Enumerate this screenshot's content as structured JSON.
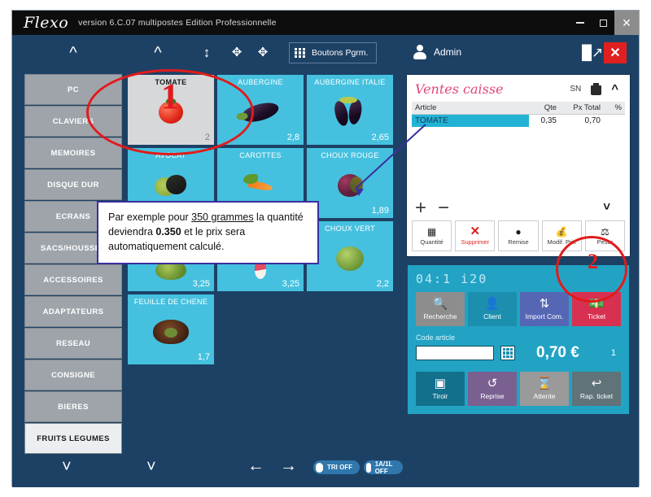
{
  "window": {
    "app_name": "Flexo",
    "version_text": "version 6.C.07 multipostes Edition Professionnelle",
    "minimize_icon": "minimize-icon",
    "maximize_icon": "maximize-icon",
    "close_icon": "close-icon"
  },
  "toolbar": {
    "icons": [
      "chevron-up-icon",
      "chevron-up-icon",
      "arrows-vertical-icon",
      "expand-icon",
      "collapse-icon"
    ],
    "pgrm_button_label": "Boutons Pgrm.",
    "user_label": "Admin",
    "theme_icon": "paint-bucket-icon",
    "close_label": "✕"
  },
  "sidebar": {
    "items": [
      {
        "label": "PC",
        "active": false
      },
      {
        "label": "CLAVIERS",
        "active": false
      },
      {
        "label": "MEMOIRES",
        "active": false
      },
      {
        "label": "DISQUE DUR",
        "active": false
      },
      {
        "label": "ECRANS",
        "active": false
      },
      {
        "label": "SACS/HOUSSES",
        "active": false
      },
      {
        "label": "ACCESSOIRES",
        "active": false
      },
      {
        "label": "ADAPTATEURS",
        "active": false
      },
      {
        "label": "RESEAU",
        "active": false
      },
      {
        "label": "CONSIGNE",
        "active": false
      },
      {
        "label": "BIERES",
        "active": false
      },
      {
        "label": "FRUITS LEGUMES",
        "active": true
      }
    ]
  },
  "product_grid": {
    "rows": [
      [
        {
          "name": "TOMATE",
          "price": "2",
          "selected": true,
          "img": "tomato"
        },
        {
          "name": "AUBERGINE",
          "price": "2,8",
          "selected": false,
          "img": "aubergine"
        },
        {
          "name": "AUBERGINE ITALIE",
          "price": "2,65",
          "selected": false,
          "img": "aubergine2"
        }
      ],
      [
        {
          "name": "AVOCAT",
          "price": "",
          "selected": false,
          "img": "avocat"
        },
        {
          "name": "CAROTTES",
          "price": "",
          "selected": false,
          "img": "carrot"
        },
        {
          "name": "CHOUX ROUGE",
          "price": "1,89",
          "selected": false,
          "img": "chourouge"
        }
      ],
      [
        {
          "name": "",
          "price": "3,25",
          "selected": false,
          "img": "salade"
        },
        {
          "name": "",
          "price": "3,25",
          "selected": false,
          "img": "radis"
        },
        {
          "name": "CHOUX VERT",
          "price": "2,2",
          "selected": false,
          "img": "chouvert"
        }
      ],
      [
        {
          "name": "FEUILLE DE CHENE",
          "price": "1,7",
          "selected": false,
          "img": "feuille"
        }
      ]
    ]
  },
  "bottom_nav": {
    "icons": [
      "chevron-down-icon",
      "chevron-down-icon",
      "arrow-left-icon",
      "arrow-right-icon"
    ],
    "toggles": [
      {
        "label": "TRI OFF"
      },
      {
        "label": "1A/1L OFF"
      }
    ]
  },
  "sale_panel": {
    "title": "Ventes caisse",
    "sn_label": "SN",
    "trash_icon": "trash-icon",
    "collapse_icon": "chevron-up-icon",
    "columns": [
      "Article",
      "Qte",
      "Px Total",
      "%"
    ],
    "rows": [
      {
        "article": "TOMATE",
        "qte": "0,35",
        "px_total": "0,70",
        "pct": "",
        "selected": true
      }
    ],
    "plus_label": "+",
    "minus_label": "−",
    "expand_icon": "chevron-down-icon",
    "actions": [
      {
        "label": "Quantité",
        "icon": "calculator-icon",
        "danger": false
      },
      {
        "label": "Supprimer",
        "icon": "cross-icon",
        "danger": true
      },
      {
        "label": "Remise",
        "icon": "percent-icon",
        "danger": false
      },
      {
        "label": "Modif. Prix",
        "icon": "money-tag-icon",
        "danger": false
      },
      {
        "label": "Peser",
        "icon": "scale-icon",
        "danger": false
      }
    ]
  },
  "cash_panel": {
    "clock": "04:1 i20",
    "top_buttons": [
      {
        "label": "Recherche",
        "icon": "search-icon",
        "color": "#8d8d8d"
      },
      {
        "label": "Client",
        "icon": "client-icon",
        "color": "#1d8fae"
      },
      {
        "label": "Import Com.",
        "icon": "import-icon",
        "color": "#5566b5"
      },
      {
        "label": "Ticket",
        "icon": "banknote-icon",
        "color": "#d83050"
      }
    ],
    "code_label": "Code article",
    "code_value": "",
    "code_placeholder": "",
    "keypad_icon": "calculator-icon",
    "total": "0,70 €",
    "item_count": "1",
    "bottom_buttons": [
      {
        "label": "Tiroir",
        "icon": "drawer-icon",
        "color": "#12708c"
      },
      {
        "label": "Reprise",
        "icon": "undo-icon",
        "color": "#7a6090"
      },
      {
        "label": "Attente",
        "icon": "hourglass-icon",
        "color": "#9a9a9a"
      },
      {
        "label": "Rap. ticket",
        "icon": "return-arrow-icon",
        "color": "#5f7379"
      }
    ]
  },
  "annotations": {
    "marker_1": "1",
    "marker_2": "2",
    "callout_line1_a": "Par exemple pour ",
    "callout_line1_b": "350 grammes",
    "callout_line1_c": " la",
    "callout_line2_a": "quantité deviendra ",
    "callout_line2_b": "0.350",
    "callout_line2_c": " et le prix",
    "callout_line3": "sera automatiquement calculé.",
    "accent_red": "#e11b1b",
    "accent_blue": "#3a2f9e"
  }
}
